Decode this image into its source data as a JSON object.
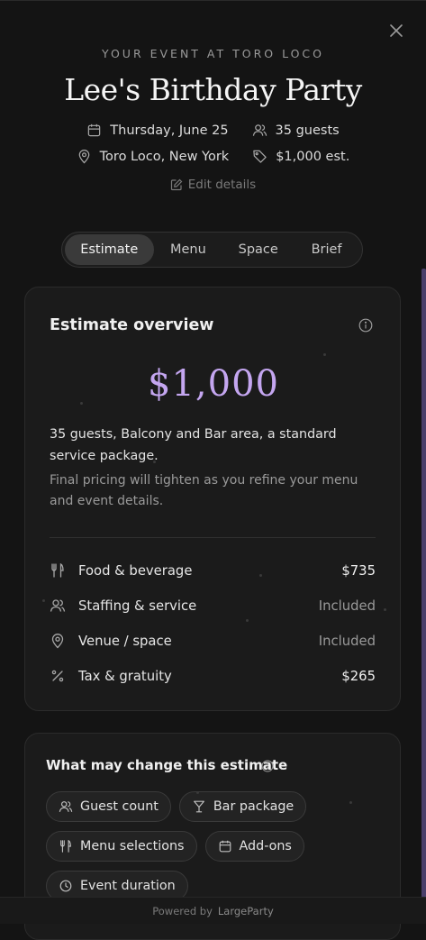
{
  "header": {
    "eyebrow": "YOUR EVENT AT TORO LOCO",
    "title": "Lee's Birthday Party",
    "date": "Thursday, June 25",
    "guests": "35 guests",
    "location": "Toro Loco, New York",
    "budget": "$1,000 est.",
    "edit_label": "Edit details"
  },
  "tabs": [
    {
      "label": "Estimate",
      "active": true
    },
    {
      "label": "Menu",
      "active": false
    },
    {
      "label": "Space",
      "active": false
    },
    {
      "label": "Brief",
      "active": false
    }
  ],
  "overview": {
    "title": "Estimate overview",
    "total": "$1,000",
    "summary": "35 guests, Balcony and Bar area, a standard service package.",
    "note": "Final pricing will tighten as you refine your menu and event details.",
    "lines": [
      {
        "icon": "utensils-icon",
        "label": "Food & beverage",
        "value": "$735"
      },
      {
        "icon": "users-icon",
        "label": "Staffing & service",
        "value": "Included"
      },
      {
        "icon": "map-pin-icon",
        "label": "Venue / space",
        "value": "Included"
      },
      {
        "icon": "percent-icon",
        "label": "Tax & gratuity",
        "value": "$265"
      }
    ]
  },
  "changes": {
    "title": "What may change this estimate",
    "chips": [
      {
        "icon": "users-icon",
        "label": "Guest count"
      },
      {
        "icon": "cocktail-icon",
        "label": "Bar package"
      },
      {
        "icon": "utensils-icon",
        "label": "Menu selections"
      },
      {
        "icon": "calendar-icon",
        "label": "Add-ons"
      },
      {
        "icon": "clock-icon",
        "label": "Event duration"
      }
    ]
  },
  "footer": {
    "powered_by": "Powered by",
    "brand": "LargeParty"
  },
  "colors": {
    "background": "#141414",
    "card": "#1b1b1b",
    "accent_price": "#c4a6f0",
    "active_tab": "#3a3a3a"
  }
}
